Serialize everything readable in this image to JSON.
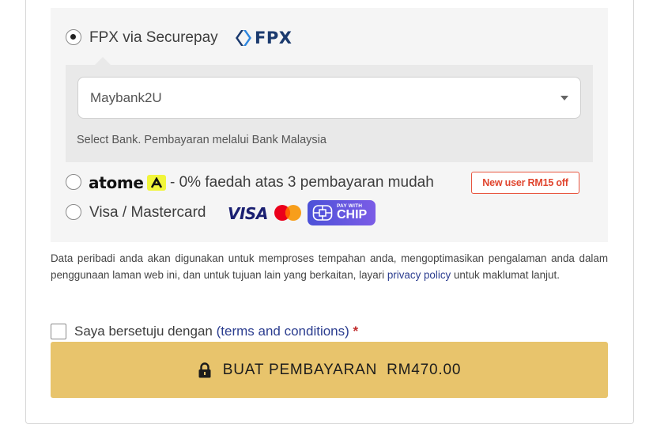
{
  "payment_methods": {
    "fpx": {
      "label": "FPX via Securepay",
      "logo_text": "FPX",
      "selected": true,
      "bank_select": {
        "value": "Maybank2U",
        "help": "Select Bank. Pembayaran melalui Bank Malaysia"
      }
    },
    "atome": {
      "logo_text": "atome",
      "description": "- 0% faedah atas 3 pembayaran mudah",
      "promo": "New user RM15 off",
      "selected": false
    },
    "card": {
      "label": "Visa / Mastercard",
      "visa_text": "VISA",
      "chip_small": "PAY WITH",
      "chip_big": "CHIP",
      "selected": false
    }
  },
  "privacy": {
    "text": "Data peribadi anda akan digunakan untuk memproses tempahan anda, mengoptimasikan pengalaman anda dalam penggunaan laman web ini, dan untuk tujuan lain yang berkaitan, layari",
    "link": "privacy policy",
    "after": "untuk maklumat lanjut."
  },
  "terms": {
    "prefix": "Saya bersetuju dengan",
    "open": "(",
    "link": "terms and conditions",
    "close": ")",
    "required": "*"
  },
  "pay_button": {
    "label": "BUAT PEMBAYARAN",
    "amount": "RM470.00"
  },
  "colors": {
    "button": "#e8c46c",
    "link": "#2b3d8f",
    "promo": "#e0452e",
    "fpx": "#1b3a6e"
  }
}
